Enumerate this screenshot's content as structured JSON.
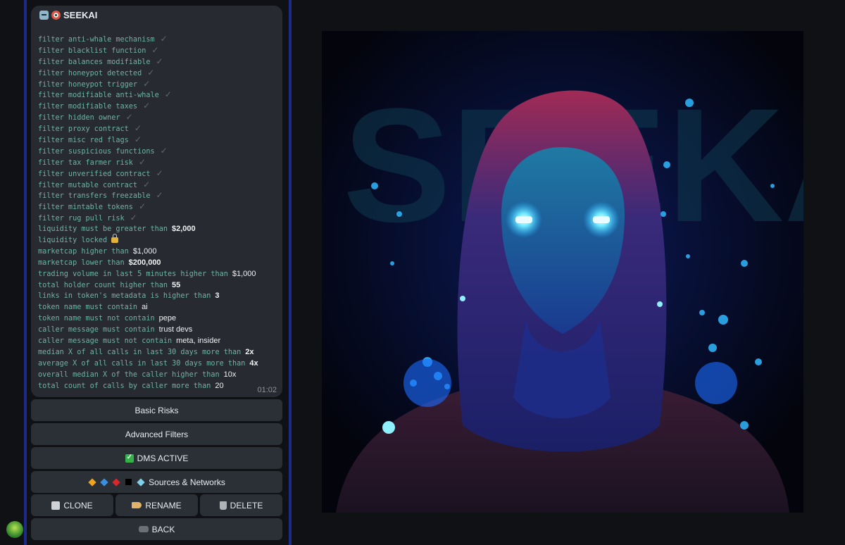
{
  "bot": {
    "name": "SEEKAI"
  },
  "message": {
    "time": "01:02",
    "lines": [
      {
        "text": "filter anti-whale mechanism",
        "check": true
      },
      {
        "text": "filter blacklist function",
        "check": true
      },
      {
        "text": "filter balances modifiable",
        "check": true
      },
      {
        "text": "filter honeypot detected",
        "check": true
      },
      {
        "text": "filter honeypot trigger",
        "check": true
      },
      {
        "text": "filter modifiable anti-whale",
        "check": true
      },
      {
        "text": "filter modifiable taxes",
        "check": true
      },
      {
        "text": "filter hidden owner",
        "check": true
      },
      {
        "text": "filter proxy contract",
        "check": true
      },
      {
        "text": "filter misc red flags",
        "check": true
      },
      {
        "text": "filter suspicious functions",
        "check": true
      },
      {
        "text": "filter tax farmer risk",
        "check": true
      },
      {
        "text": "filter unverified contract",
        "check": true
      },
      {
        "text": "filter mutable contract",
        "check": true
      },
      {
        "text": "filter transfers freezable",
        "check": true
      },
      {
        "text": "filter mintable tokens",
        "check": true
      },
      {
        "text": "filter rug pull risk",
        "check": true
      },
      {
        "text": "liquidity must be greater than",
        "value": "$2,000",
        "bold": true
      },
      {
        "text": "liquidity locked",
        "lock": true
      },
      {
        "text": "marketcap higher than",
        "value": "$1,000",
        "bold": false
      },
      {
        "text": "marketcap lower than",
        "value": "$200,000",
        "bold": true
      },
      {
        "text": "trading volume in last 5 minutes higher than",
        "value": "$1,000",
        "bold": false
      },
      {
        "text": "total holder count higher than",
        "value": "55",
        "bold": true
      },
      {
        "text": "links in token's metadata is higher than",
        "value": "3",
        "bold": true
      },
      {
        "text": "token name must contain",
        "value": "ai",
        "bold": false
      },
      {
        "text": "token name must not contain",
        "value": "pepe",
        "bold": false
      },
      {
        "text": "caller message must contain",
        "value": "trust devs",
        "bold": false
      },
      {
        "text": "caller message must not contain",
        "value": "meta, insider",
        "bold": false
      },
      {
        "text": "median X of all calls in last 30 days more than",
        "value": "2x",
        "bold": true
      },
      {
        "text": "average X of all calls in last 30 days more than",
        "value": "4x",
        "bold": true
      },
      {
        "text": "overall median X of the caller higher than",
        "value": "10x",
        "bold": false
      },
      {
        "text": "total count of calls by caller more than",
        "value": "20",
        "bold": false
      }
    ]
  },
  "buttons": {
    "basic_risks": "Basic Risks",
    "advanced_filters": "Advanced Filters",
    "dms_active": "DMS ACTIVE",
    "sources_networks": "Sources & Networks",
    "clone": "CLONE",
    "rename": "RENAME",
    "delete": "DELETE",
    "back": "BACK"
  },
  "colors": {
    "panel": "#272a30",
    "button": "#2b2f36",
    "mono_text": "#6fb3a4",
    "rail": "#1d2a8a",
    "dms_check": "#34b24a"
  },
  "artwork": {
    "watermark": "SEEKAI"
  }
}
